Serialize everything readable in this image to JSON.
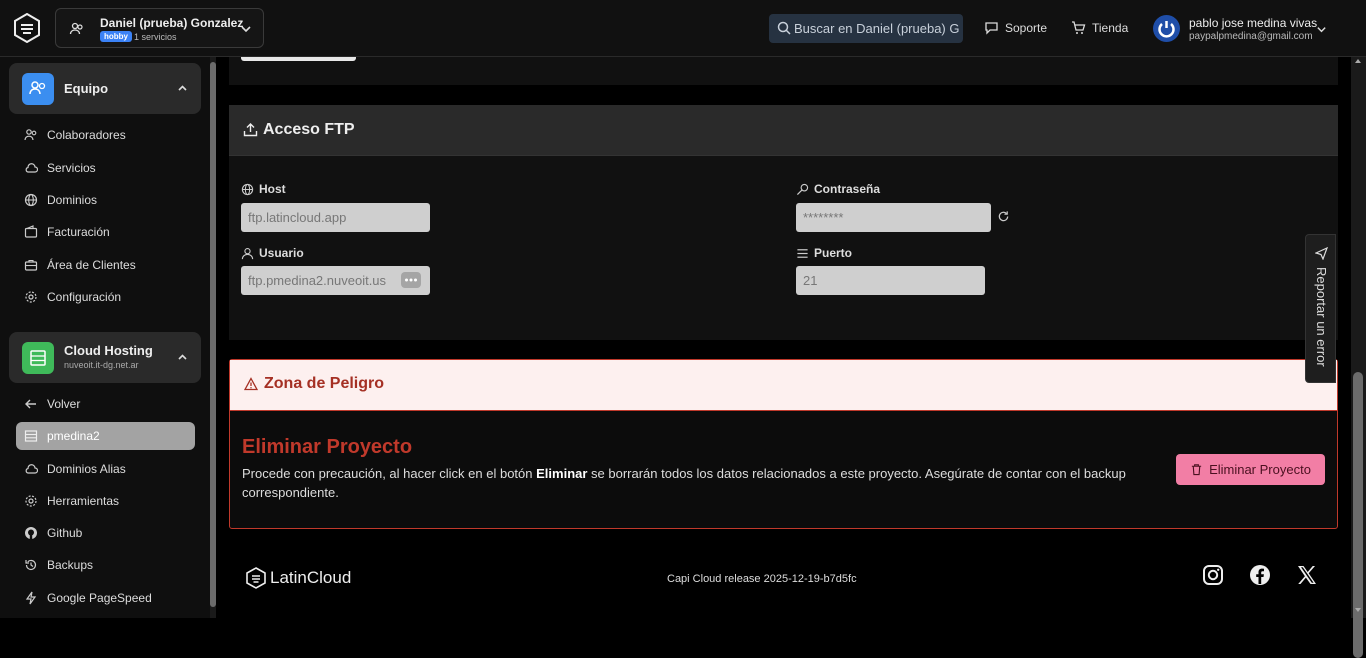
{
  "topbar": {
    "account_name": "Daniel (prueba) Gonzalez",
    "account_badge": "hobby",
    "account_services": "1 servicios",
    "search_placeholder": "Buscar en Daniel (prueba) G",
    "support_label": "Soporte",
    "store_label": "Tienda",
    "user_name": "pablo jose medina vivas",
    "user_email": "paypalpmedina@gmail.com"
  },
  "sidebar": {
    "team_group": {
      "title": "Equipo",
      "color": "#3b8ef0"
    },
    "team_items": [
      {
        "label": "Colaboradores",
        "icon": "users-icon"
      },
      {
        "label": "Servicios",
        "icon": "cloud-icon"
      },
      {
        "label": "Dominios",
        "icon": "globe-icon"
      },
      {
        "label": "Facturación",
        "icon": "wallet-icon"
      },
      {
        "label": "Área de Clientes",
        "icon": "briefcase-icon"
      },
      {
        "label": "Configuración",
        "icon": "gear-icon"
      }
    ],
    "hosting_group": {
      "title": "Cloud Hosting",
      "subtitle": "nuveoit.it-dg.net.ar",
      "color": "#3fba5a"
    },
    "hosting_items": [
      {
        "label": "Volver",
        "icon": "arrow-left-icon"
      },
      {
        "label": "pmedina2",
        "icon": "server-icon",
        "active": true
      },
      {
        "label": "Dominios Alias",
        "icon": "cloud-icon"
      },
      {
        "label": "Herramientas",
        "icon": "gear-icon"
      },
      {
        "label": "Github",
        "icon": "github-icon"
      },
      {
        "label": "Backups",
        "icon": "history-icon"
      },
      {
        "label": "Google PageSpeed",
        "icon": "bolt-icon"
      }
    ]
  },
  "ftp": {
    "title": "Acceso FTP",
    "host_label": "Host",
    "host_value": "ftp.latincloud.app",
    "password_label": "Contraseña",
    "password_value": "********",
    "user_label": "Usuario",
    "user_value": "ftp.pmedina2.nuveoit.us",
    "port_label": "Puerto",
    "port_value": "21"
  },
  "danger": {
    "header": "Zona de Peligro",
    "title": "Eliminar Proyecto",
    "text_before": "Procede con precaución, al hacer click en el botón ",
    "text_bold": "Eliminar",
    "text_after": " se borrarán todos los datos relacionados a este proyecto. Asegúrate de contar con el backup correspondiente.",
    "button_label": "Eliminar Proyecto"
  },
  "footer": {
    "brand": "LatinCloud",
    "release": "Capi Cloud release 2025-12-19-b7d5fc"
  },
  "report_label": "Reportar un error"
}
